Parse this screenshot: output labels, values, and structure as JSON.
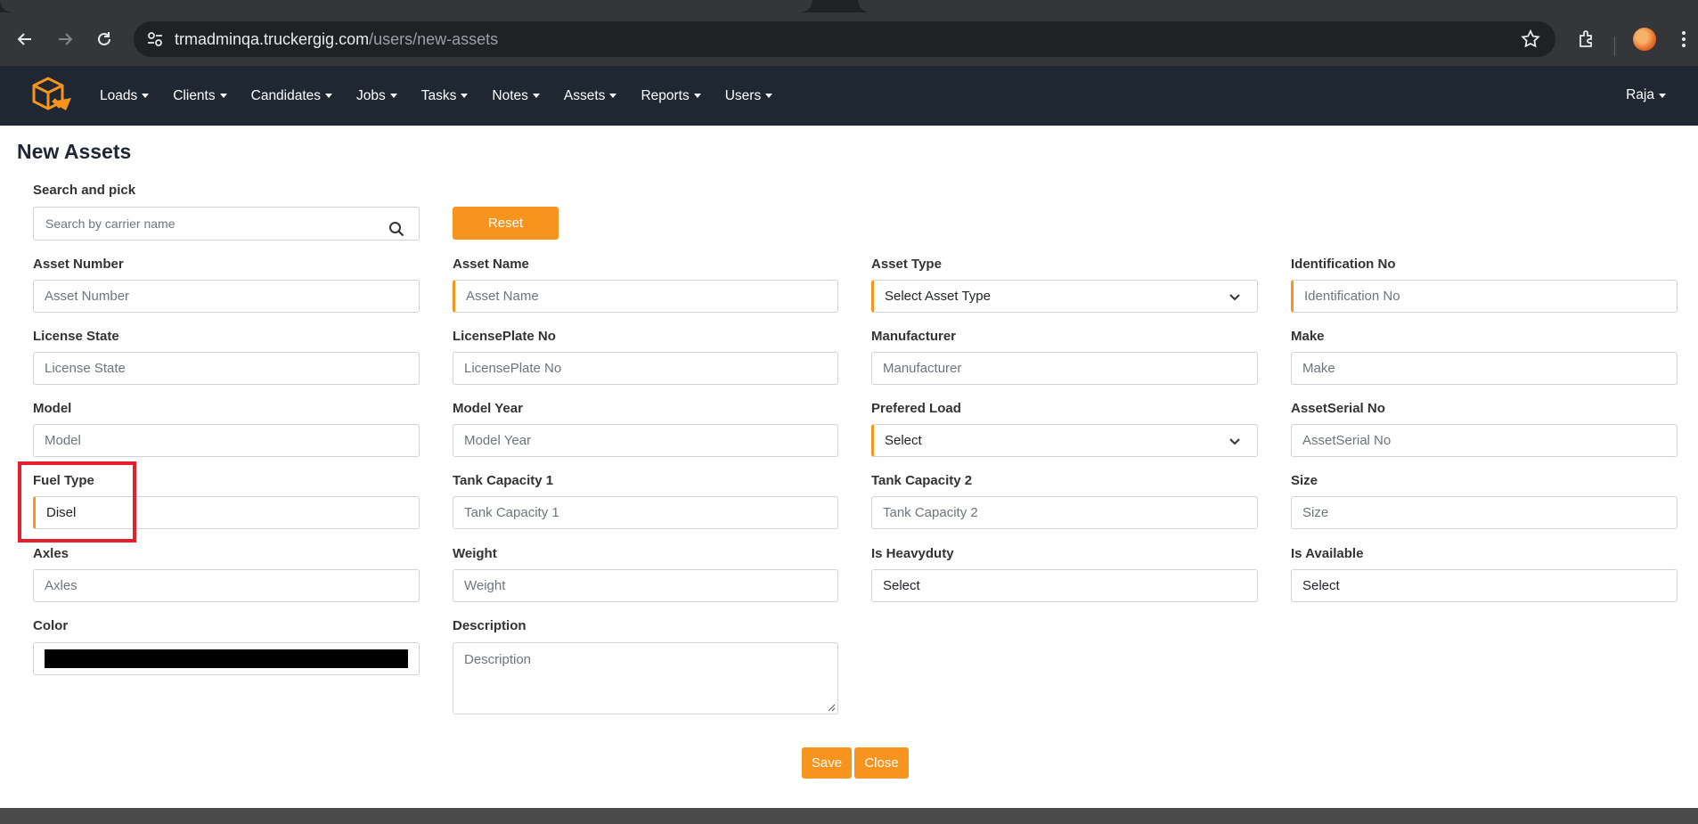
{
  "browser": {
    "url_host": "trmadminqa.truckergig.com",
    "url_path": "/users/new-assets"
  },
  "navbar": {
    "menu": [
      {
        "label": "Loads"
      },
      {
        "label": "Clients"
      },
      {
        "label": "Candidates"
      },
      {
        "label": "Jobs"
      },
      {
        "label": "Tasks"
      },
      {
        "label": "Notes"
      },
      {
        "label": "Assets"
      },
      {
        "label": "Reports"
      },
      {
        "label": "Users"
      }
    ],
    "user": "Raja"
  },
  "page": {
    "title": "New Assets"
  },
  "search": {
    "label": "Search and pick",
    "placeholder": "Search by carrier name",
    "reset_label": "Reset"
  },
  "form": {
    "asset_number": {
      "label": "Asset Number",
      "placeholder": "Asset Number"
    },
    "asset_name": {
      "label": "Asset Name",
      "placeholder": "Asset Name"
    },
    "asset_type": {
      "label": "Asset Type",
      "value": "Select Asset Type"
    },
    "identification_no": {
      "label": "Identification No",
      "placeholder": "Identification No"
    },
    "license_state": {
      "label": "License State",
      "placeholder": "License State"
    },
    "licenseplate_no": {
      "label": "LicensePlate No",
      "placeholder": "LicensePlate No"
    },
    "manufacturer": {
      "label": "Manufacturer",
      "placeholder": "Manufacturer"
    },
    "make": {
      "label": "Make",
      "placeholder": "Make"
    },
    "model": {
      "label": "Model",
      "placeholder": "Model"
    },
    "model_year": {
      "label": "Model Year",
      "placeholder": "Model Year"
    },
    "prefered_load": {
      "label": "Prefered Load",
      "value": "Select"
    },
    "assetserial_no": {
      "label": "AssetSerial No",
      "placeholder": "AssetSerial No"
    },
    "fuel_type": {
      "label": "Fuel Type",
      "value": "Disel"
    },
    "tank_capacity_1": {
      "label": "Tank Capacity 1",
      "placeholder": "Tank Capacity 1"
    },
    "tank_capacity_2": {
      "label": "Tank Capacity 2",
      "placeholder": "Tank Capacity 2"
    },
    "size": {
      "label": "Size",
      "placeholder": "Size"
    },
    "axles": {
      "label": "Axles",
      "placeholder": "Axles"
    },
    "weight": {
      "label": "Weight",
      "placeholder": "Weight"
    },
    "is_heavyduty": {
      "label": "Is Heavyduty",
      "value": "Select"
    },
    "is_available": {
      "label": "Is Available",
      "value": "Select"
    },
    "color": {
      "label": "Color",
      "value": "#000000"
    },
    "description": {
      "label": "Description",
      "placeholder": "Description"
    }
  },
  "actions": {
    "save_label": "Save",
    "close_label": "Close"
  },
  "colors": {
    "accent": "#f7941d",
    "navbar": "#1f2733",
    "highlight": "#e3202b"
  }
}
